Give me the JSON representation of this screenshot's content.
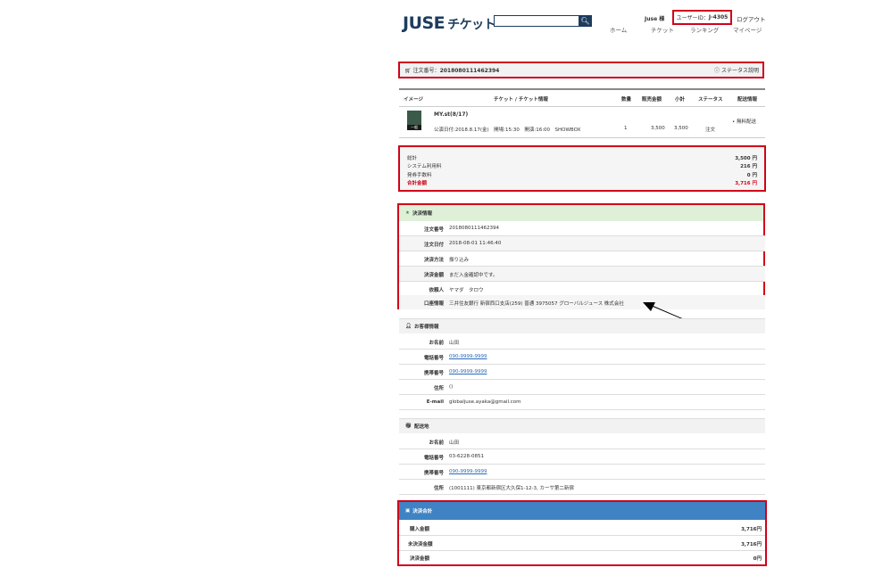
{
  "header": {
    "logo_main": "JUSE",
    "logo_sub": "チケット",
    "search_placeholder": "",
    "search_icon": "magnifier-icon",
    "user_name": "Juse 様",
    "user_id_label": "ユーザーID：",
    "user_id": "J-4305",
    "logout": "ログアウト",
    "nav": [
      "ホーム",
      "チケット",
      "ランキング",
      "マイページ"
    ]
  },
  "order": {
    "label": "注文番号：",
    "number": "2018080111462394",
    "status_link": "ステータス説明"
  },
  "table": {
    "headers": [
      "イメージ",
      "チケット / チケット情報",
      "数量",
      "販売金額",
      "小計",
      "ステータス",
      "配送情報"
    ],
    "item": {
      "thumb_label": "一般",
      "title": "MY.st(8/17)",
      "detail": "公演日付:2018.8.17(金)　開場:15:30　開演:16:00　SHOWBOX",
      "qty": "1",
      "price": "3,500",
      "subtotal": "3,500",
      "status": "注文",
      "delivery": "• 無料配送"
    }
  },
  "totals": [
    {
      "label": "総計",
      "value": "3,500 円"
    },
    {
      "label": "システム利用料",
      "value": "216 円"
    },
    {
      "label": "発券手数料",
      "value": "0 円"
    },
    {
      "label": "合計金額",
      "value": "3,716 円"
    }
  ],
  "payment_info": {
    "title": "決済情報",
    "rows": [
      {
        "k": "注文番号",
        "v": "2018080111462394"
      },
      {
        "k": "注文日付",
        "v": "2018-08-01 11:46:40"
      },
      {
        "k": "決済方法",
        "v": "振り込み"
      },
      {
        "k": "決済金額",
        "v": "まだ入金確認中です。"
      },
      {
        "k": "依頼人",
        "v": "ヤマダ　タロウ"
      },
      {
        "k": "口座情報",
        "v": "三井住友銀行 新宿西口支店(259) 普通 3975057 グローバルジュース 株式会社"
      }
    ]
  },
  "customer_info": {
    "title": "お客様情報",
    "rows": [
      {
        "k": "お名前",
        "v": "山田"
      },
      {
        "k": "電話番号",
        "v": "090-9999-9999"
      },
      {
        "k": "携帯番号",
        "v": "090-9999-9999"
      },
      {
        "k": "住所",
        "v": "()"
      },
      {
        "k": "E-mail",
        "v": "globaljuse.ayaka@gmail.com"
      }
    ]
  },
  "delivery_info": {
    "title": "配送地",
    "rows": [
      {
        "k": "お名前",
        "v": "山田"
      },
      {
        "k": "電話番号",
        "v": "03-6228-0851"
      },
      {
        "k": "携帯番号",
        "v": "090-9999-9999"
      },
      {
        "k": "住所",
        "v": "(1001111) 東京都新宿区大久保1-12-3, カーサ第二新宿"
      }
    ]
  },
  "payment_total": {
    "title": "決済合計",
    "rows": [
      {
        "k": "購入金額",
        "v": "3,716円"
      },
      {
        "k": "未決済金額",
        "v": "3,716円"
      },
      {
        "k": "決済金額",
        "v": "0円"
      }
    ]
  },
  "colors": {
    "accent": "#1d3c5e",
    "highlight": "#d0021b",
    "pay_header": "#3f83c4",
    "link": "#2a6bb8"
  }
}
